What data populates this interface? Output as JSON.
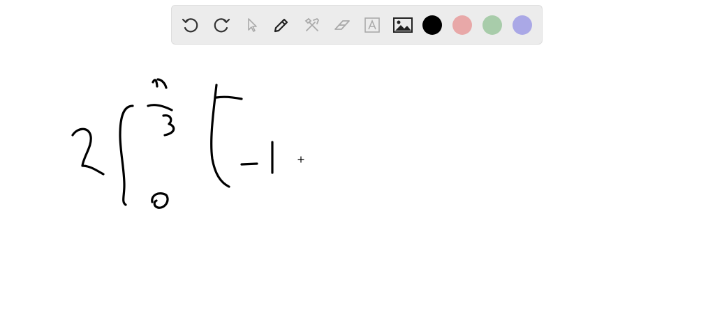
{
  "toolbar": {
    "tools": [
      {
        "name": "undo-icon",
        "enabled": true
      },
      {
        "name": "redo-icon",
        "enabled": true
      },
      {
        "name": "select-pointer-icon",
        "enabled": false
      },
      {
        "name": "pen-icon",
        "enabled": true
      },
      {
        "name": "tools-icon",
        "enabled": false
      },
      {
        "name": "eraser-icon",
        "enabled": false
      },
      {
        "name": "text-box-icon",
        "enabled": false
      },
      {
        "name": "image-icon",
        "enabled": true
      }
    ],
    "colors": [
      {
        "name": "color-black",
        "hex": "#000000",
        "selected": true
      },
      {
        "name": "color-red",
        "hex": "#e8a8a8"
      },
      {
        "name": "color-green",
        "hex": "#a8ccaa"
      },
      {
        "name": "color-blue",
        "hex": "#aaa8e6"
      }
    ]
  },
  "canvas": {
    "background": "#ffffff",
    "ink_color": "#000000",
    "handwriting": "2 ∫₀^(π/3) ( −1"
  }
}
